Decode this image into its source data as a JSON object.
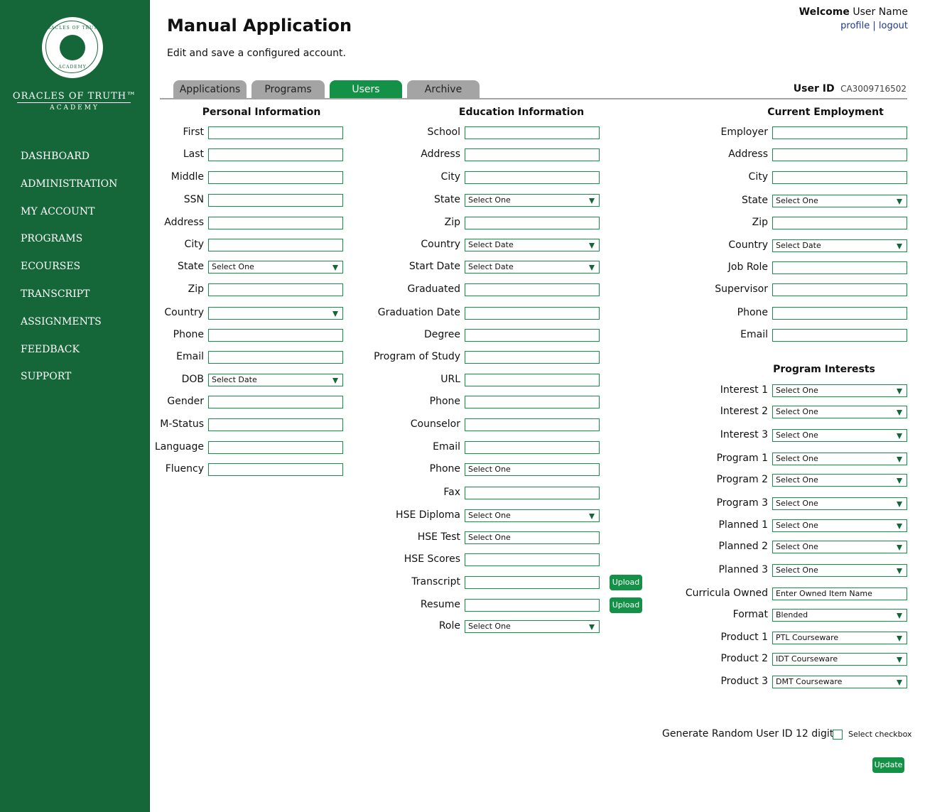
{
  "brand": {
    "name": "ORACLES OF TRUTH™",
    "sub": "ACADEMY",
    "seal_top": "ORACLES OF TRUTH",
    "seal_bottom": "ACADEMY"
  },
  "sidebar": {
    "items": [
      {
        "label": "DASHBOARD"
      },
      {
        "label": "ADMINISTRATION"
      },
      {
        "label": "MY ACCOUNT"
      },
      {
        "label": "PROGRAMS"
      },
      {
        "label": "ECOURSES"
      },
      {
        "label": "TRANSCRIPT"
      },
      {
        "label": "ASSIGNMENTS"
      },
      {
        "label": "FEEDBACK"
      },
      {
        "label": "SUPPORT"
      }
    ]
  },
  "header": {
    "title": "Manual Application",
    "subtitle": "Edit and save a configured account.",
    "welcome_label": "Welcome",
    "user_name": "User Name",
    "profile_link": "profile",
    "separator": "|",
    "logout_link": "logout"
  },
  "tabs": [
    {
      "label": "Applications",
      "active": false
    },
    {
      "label": "Programs",
      "active": false
    },
    {
      "label": "Users",
      "active": true
    },
    {
      "label": "Archive",
      "active": false
    }
  ],
  "user_id": {
    "label": "User ID",
    "value": "CA3009716502"
  },
  "personal": {
    "title": "Personal Information",
    "fields": [
      {
        "label": "First",
        "value": "",
        "type": "text"
      },
      {
        "label": "Last",
        "value": "",
        "type": "text"
      },
      {
        "label": "Middle",
        "value": "",
        "type": "text"
      },
      {
        "label": "SSN",
        "value": "",
        "type": "text"
      },
      {
        "label": "Address",
        "value": "",
        "type": "text"
      },
      {
        "label": "City",
        "value": "",
        "type": "text"
      },
      {
        "label": "State",
        "value": "Select One",
        "type": "select"
      },
      {
        "label": "Zip",
        "value": "",
        "type": "text"
      },
      {
        "label": "Country",
        "value": "",
        "type": "select"
      },
      {
        "label": "Phone",
        "value": "",
        "type": "text"
      },
      {
        "label": "Email",
        "value": "",
        "type": "text"
      },
      {
        "label": "DOB",
        "value": "Select Date",
        "type": "select"
      },
      {
        "label": "Gender",
        "value": "",
        "type": "text"
      },
      {
        "label": "M-Status",
        "value": "",
        "type": "text"
      },
      {
        "label": "Language",
        "value": "",
        "type": "text"
      },
      {
        "label": "Fluency",
        "value": "",
        "type": "text"
      }
    ]
  },
  "education": {
    "title": "Education Information",
    "fields": [
      {
        "label": "School",
        "value": "",
        "type": "text"
      },
      {
        "label": "Address",
        "value": "",
        "type": "text"
      },
      {
        "label": "City",
        "value": "",
        "type": "text"
      },
      {
        "label": "State",
        "value": "Select One",
        "type": "select"
      },
      {
        "label": "Zip",
        "value": "",
        "type": "text"
      },
      {
        "label": "Country",
        "value": "Select Date",
        "type": "select"
      },
      {
        "label": "Start Date",
        "value": "Select Date",
        "type": "select"
      },
      {
        "label": "Graduated",
        "value": "",
        "type": "text"
      },
      {
        "label": "Graduation Date",
        "value": "",
        "type": "text"
      },
      {
        "label": "Degree",
        "value": "",
        "type": "text"
      },
      {
        "label": "Program of Study",
        "value": "",
        "type": "text"
      },
      {
        "label": "URL",
        "value": "",
        "type": "text"
      },
      {
        "label": "Phone",
        "value": "",
        "type": "text"
      },
      {
        "label": "Counselor",
        "value": "",
        "type": "text"
      },
      {
        "label": "Email",
        "value": "",
        "type": "text"
      },
      {
        "label": "Phone",
        "value": "Select One",
        "type": "text"
      },
      {
        "label": "Fax",
        "value": "",
        "type": "text"
      },
      {
        "label": "HSE Diploma",
        "value": "Select One",
        "type": "select"
      },
      {
        "label": "HSE Test",
        "value": "Select One",
        "type": "text"
      },
      {
        "label": "HSE Scores",
        "value": "",
        "type": "text"
      },
      {
        "label": "Transcript",
        "value": "",
        "type": "text",
        "button": "Upload"
      },
      {
        "label": "Resume",
        "value": "",
        "type": "text",
        "button": "Upload"
      },
      {
        "label": "Role",
        "value": "Select One",
        "type": "select"
      }
    ]
  },
  "employment": {
    "title": "Current Employment",
    "fields": [
      {
        "label": "Employer",
        "value": "",
        "type": "text"
      },
      {
        "label": "Address",
        "value": "",
        "type": "text"
      },
      {
        "label": "City",
        "value": "",
        "type": "text"
      },
      {
        "label": "State",
        "value": "Select One",
        "type": "select"
      },
      {
        "label": "Zip",
        "value": "",
        "type": "text"
      },
      {
        "label": "Country",
        "value": "Select Date",
        "type": "select"
      },
      {
        "label": "Job Role",
        "value": "",
        "type": "text"
      },
      {
        "label": "Supervisor",
        "value": "",
        "type": "text"
      },
      {
        "label": "Phone",
        "value": "",
        "type": "text"
      },
      {
        "label": "Email",
        "value": "",
        "type": "text"
      }
    ]
  },
  "interests": {
    "title": "Program Interests",
    "fields": [
      {
        "label": "Interest 1",
        "value": "Select One",
        "type": "select"
      },
      {
        "label": "Interest 2",
        "value": "Select One",
        "type": "select"
      },
      {
        "label": "Interest 3",
        "value": "Select One",
        "type": "select"
      },
      {
        "label": "Program 1",
        "value": "Select One",
        "type": "select"
      },
      {
        "label": "Program 2",
        "value": "Select One",
        "type": "select"
      },
      {
        "label": "Program 3",
        "value": "Select One",
        "type": "select"
      },
      {
        "label": "Planned 1",
        "value": "Select One",
        "type": "select"
      },
      {
        "label": "Planned 2",
        "value": "Select One",
        "type": "select"
      },
      {
        "label": "Planned 3",
        "value": "Select One",
        "type": "select"
      },
      {
        "label": "Curricula Owned",
        "value": "Enter Owned Item Name",
        "type": "text"
      },
      {
        "label": "Format",
        "value": "Blended",
        "type": "select"
      },
      {
        "label": "Product 1",
        "value": "PTL Courseware",
        "type": "select"
      },
      {
        "label": "Product 2",
        "value": "IDT Courseware",
        "type": "select"
      },
      {
        "label": "Product 3",
        "value": "DMT Courseware",
        "type": "select"
      }
    ]
  },
  "footer": {
    "random_label": "Generate Random User ID 12 digits",
    "checkbox_label": "Select checkbox",
    "checked": false,
    "update_button": "Update"
  },
  "colors": {
    "sidebar": "#15673a",
    "accent": "#139146",
    "tab_inactive": "#a4a4a4",
    "link": "#1d3a8c"
  }
}
